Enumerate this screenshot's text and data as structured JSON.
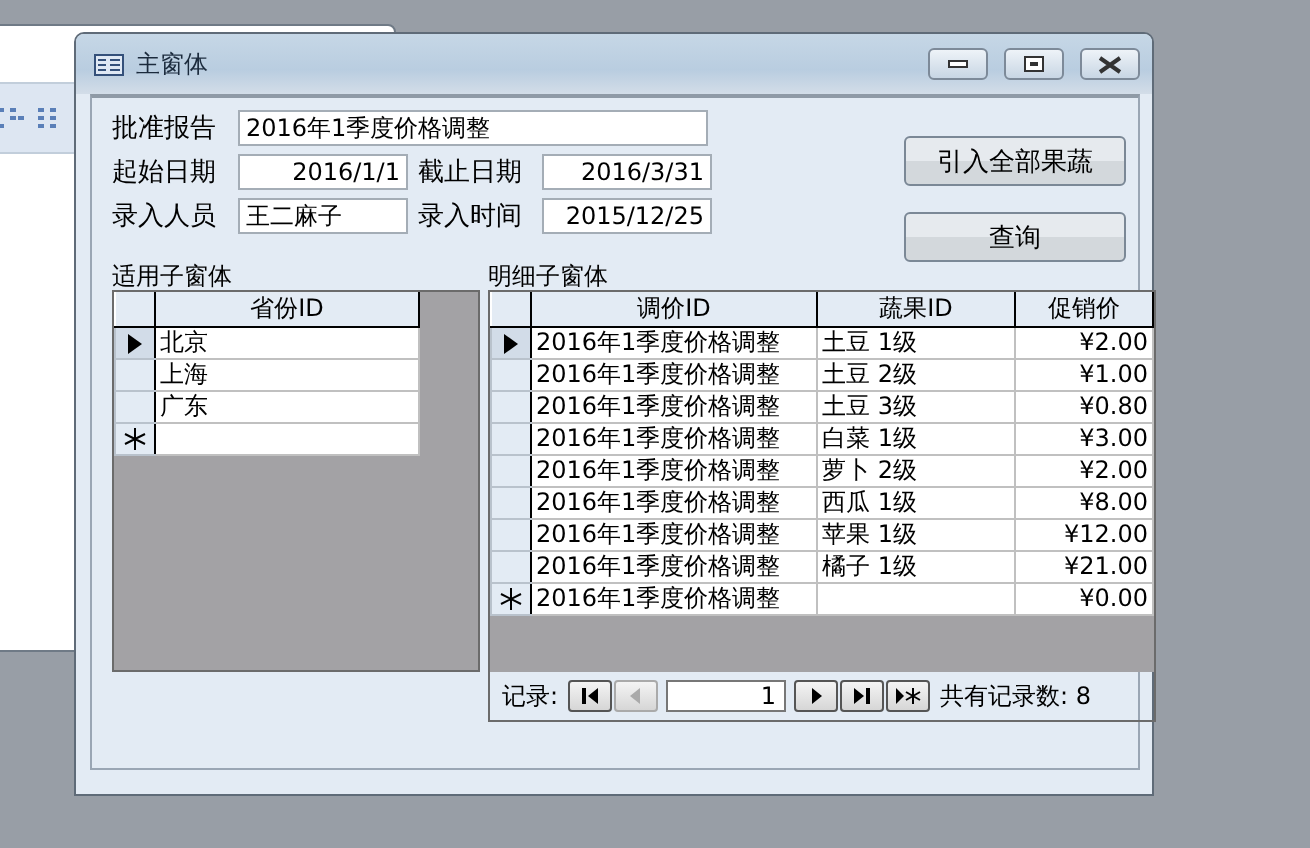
{
  "window": {
    "title": "主窗体"
  },
  "form": {
    "report": {
      "label": "批准报告",
      "value": "2016年1季度价格调整"
    },
    "start_date": {
      "label": "起始日期",
      "value": "2016/1/1"
    },
    "end_date": {
      "label": "截止日期",
      "value": "2016/3/31"
    },
    "entered_by": {
      "label": "录入人员",
      "value": "王二麻子"
    },
    "entered_at": {
      "label": "录入时间",
      "value": "2015/12/25"
    }
  },
  "buttons": [
    {
      "label": "引入全部果蔬"
    },
    {
      "label": "查询"
    }
  ],
  "region_subform": {
    "label": "适用子窗体",
    "columns": [
      "省份ID"
    ],
    "rows": [
      {
        "kind": "record",
        "current": true,
        "province": "北京"
      },
      {
        "kind": "record",
        "current": false,
        "province": "上海"
      },
      {
        "kind": "record",
        "current": false,
        "province": "广东"
      },
      {
        "kind": "new",
        "current": false
      }
    ]
  },
  "detail_subform": {
    "label": "明细子窗体",
    "columns": [
      "调价ID",
      "蔬果ID",
      "促销价"
    ],
    "rows": [
      {
        "kind": "record",
        "current": true,
        "adjust_id": "2016年1季度价格调整",
        "product_id": "土豆 1级",
        "price": "¥2.00"
      },
      {
        "kind": "record",
        "current": false,
        "adjust_id": "2016年1季度价格调整",
        "product_id": "土豆 2级",
        "price": "¥1.00"
      },
      {
        "kind": "record",
        "current": false,
        "adjust_id": "2016年1季度价格调整",
        "product_id": "土豆 3级",
        "price": "¥0.80"
      },
      {
        "kind": "record",
        "current": false,
        "adjust_id": "2016年1季度价格调整",
        "product_id": "白菜 1级",
        "price": "¥3.00"
      },
      {
        "kind": "record",
        "current": false,
        "adjust_id": "2016年1季度价格调整",
        "product_id": "萝卜 2级",
        "price": "¥2.00"
      },
      {
        "kind": "record",
        "current": false,
        "adjust_id": "2016年1季度价格调整",
        "product_id": "西瓜 1级",
        "price": "¥8.00"
      },
      {
        "kind": "record",
        "current": false,
        "adjust_id": "2016年1季度价格调整",
        "product_id": "苹果 1级",
        "price": "¥12.00"
      },
      {
        "kind": "record",
        "current": false,
        "adjust_id": "2016年1季度价格调整",
        "product_id": "橘子 1级",
        "price": "¥21.00"
      },
      {
        "kind": "new",
        "current": false,
        "adjust_id": "2016年1季度价格调整",
        "price": "¥0.00"
      }
    ],
    "navigation": {
      "label": "记录:",
      "buttons": [
        {
          "kind": "first",
          "disabled": false
        },
        {
          "kind": "prev",
          "disabled": true
        },
        {
          "kind": "next",
          "disabled": false
        },
        {
          "kind": "last",
          "disabled": false
        },
        {
          "kind": "new",
          "disabled": false
        }
      ],
      "current": "1",
      "total": "共有记录数: 8"
    }
  }
}
